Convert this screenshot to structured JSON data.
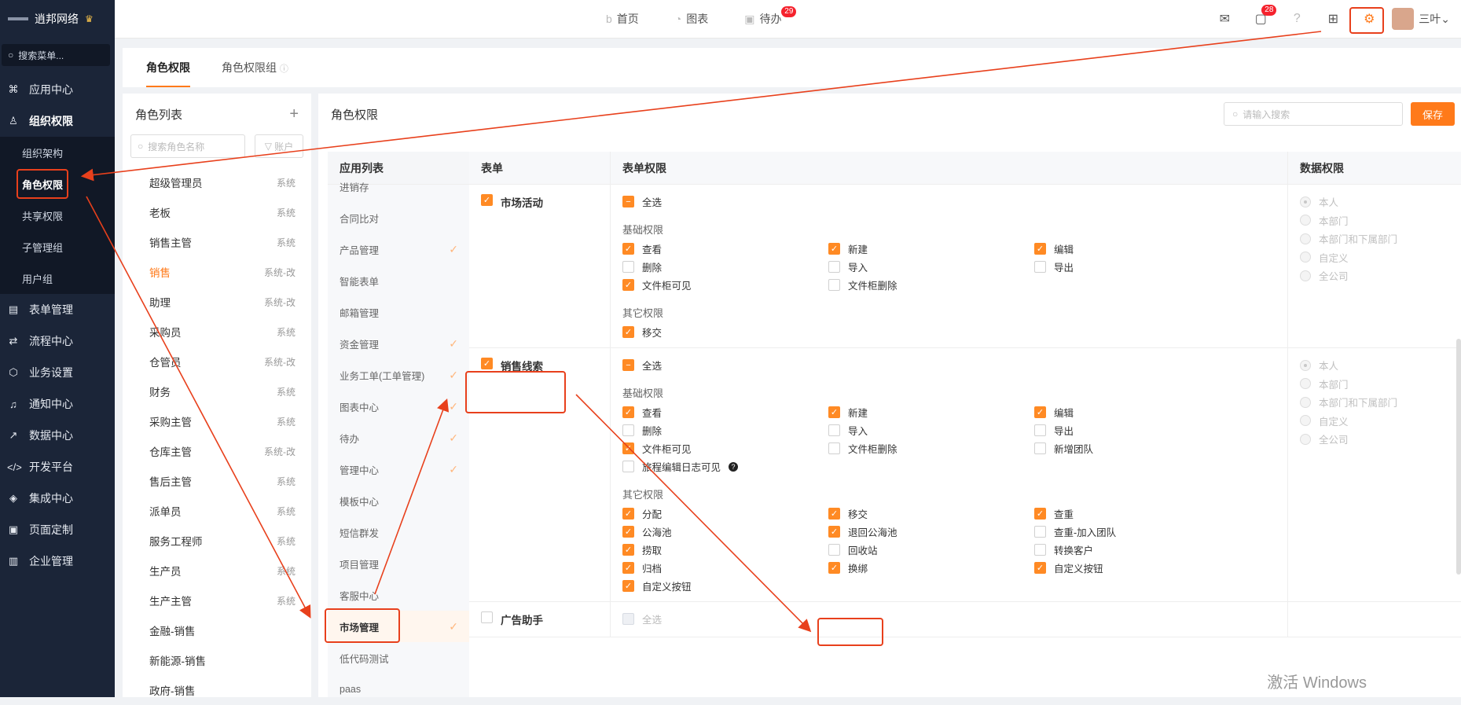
{
  "brand": {
    "name": "逍邦网络"
  },
  "sidebar": {
    "search_placeholder": "搜索菜单...",
    "items": [
      {
        "label": "应用中心",
        "icon": "grid-icon"
      },
      {
        "label": "组织权限",
        "icon": "user-icon"
      },
      {
        "label": "表单管理",
        "icon": "list-icon"
      },
      {
        "label": "流程中心",
        "icon": "flow-icon"
      },
      {
        "label": "业务设置",
        "icon": "cube-icon"
      },
      {
        "label": "通知中心",
        "icon": "bell-icon"
      },
      {
        "label": "数据中心",
        "icon": "chart-icon"
      },
      {
        "label": "开发平台",
        "icon": "code-icon"
      },
      {
        "label": "集成中心",
        "icon": "layers-icon"
      },
      {
        "label": "页面定制",
        "icon": "page-icon"
      },
      {
        "label": "企业管理",
        "icon": "building-icon"
      }
    ],
    "subitems": [
      "组织架构",
      "角色权限",
      "共享权限",
      "子管理组",
      "用户组"
    ]
  },
  "topnav": {
    "home": "首页",
    "charts": "图表",
    "todo": "待办",
    "todo_badge": "29",
    "msg_badge": "28",
    "user": "三叶"
  },
  "tabs": [
    "角色权限",
    "角色权限组"
  ],
  "role_list": {
    "title": "角色列表",
    "search_placeholder": "搜索角色名称",
    "filter": "账户",
    "roles": [
      {
        "name": "超级管理员",
        "tag": "系统"
      },
      {
        "name": "老板",
        "tag": "系统"
      },
      {
        "name": "销售主管",
        "tag": "系统"
      },
      {
        "name": "销售",
        "tag": "系统-改"
      },
      {
        "name": "助理",
        "tag": "系统-改"
      },
      {
        "name": "采购员",
        "tag": "系统"
      },
      {
        "name": "仓管员",
        "tag": "系统-改"
      },
      {
        "name": "财务",
        "tag": "系统"
      },
      {
        "name": "采购主管",
        "tag": "系统"
      },
      {
        "name": "仓库主管",
        "tag": "系统-改"
      },
      {
        "name": "售后主管",
        "tag": "系统"
      },
      {
        "name": "派单员",
        "tag": "系统"
      },
      {
        "name": "服务工程师",
        "tag": "系统"
      },
      {
        "name": "生产员",
        "tag": "系统"
      },
      {
        "name": "生产主管",
        "tag": "系统"
      },
      {
        "name": "金融-销售",
        "tag": ""
      },
      {
        "name": "新能源-销售",
        "tag": ""
      },
      {
        "name": "政府-销售",
        "tag": ""
      }
    ]
  },
  "main": {
    "title": "角色权限",
    "search_placeholder": "请输入搜索",
    "save": "保存",
    "col_app": "应用列表",
    "col_form": "表单",
    "col_perm": "表单权限",
    "col_data": "数据权限",
    "apps": [
      {
        "label": "进销存",
        "checked": false
      },
      {
        "label": "合同比对",
        "checked": false
      },
      {
        "label": "产品管理",
        "checked": true
      },
      {
        "label": "智能表单",
        "checked": false
      },
      {
        "label": "邮箱管理",
        "checked": false
      },
      {
        "label": "资金管理",
        "checked": true
      },
      {
        "label": "业务工单(工单管理)",
        "checked": true
      },
      {
        "label": "图表中心",
        "checked": true
      },
      {
        "label": "待办",
        "checked": true
      },
      {
        "label": "管理中心",
        "checked": true
      },
      {
        "label": "模板中心",
        "checked": false
      },
      {
        "label": "短信群发",
        "checked": false
      },
      {
        "label": "项目管理",
        "checked": false
      },
      {
        "label": "客服中心",
        "checked": false
      },
      {
        "label": "市场管理",
        "checked": true
      },
      {
        "label": "低代码测试",
        "checked": false
      },
      {
        "label": "paas",
        "checked": false
      }
    ],
    "select_all": "全选",
    "basic": "基础权限",
    "other": "其它权限",
    "forms": [
      {
        "name": "市场活动",
        "basic": [
          [
            "查看",
            true
          ],
          [
            "新建",
            true
          ],
          [
            "编辑",
            true
          ],
          [
            "删除",
            false
          ],
          [
            "导入",
            false
          ],
          [
            "导出",
            false
          ],
          [
            "文件柜可见",
            true
          ],
          [
            "文件柜删除",
            false
          ]
        ],
        "other": [
          [
            "移交",
            true
          ]
        ]
      },
      {
        "name": "销售线索",
        "basic": [
          [
            "查看",
            true
          ],
          [
            "新建",
            true
          ],
          [
            "编辑",
            true
          ],
          [
            "删除",
            false
          ],
          [
            "导入",
            false
          ],
          [
            "导出",
            false
          ],
          [
            "文件柜可见",
            true
          ],
          [
            "文件柜删除",
            false
          ],
          [
            "新增团队",
            false
          ],
          [
            "旅程编辑日志可见",
            false
          ]
        ],
        "other": [
          [
            "分配",
            true
          ],
          [
            "移交",
            true
          ],
          [
            "查重",
            true
          ],
          [
            "公海池",
            true
          ],
          [
            "退回公海池",
            true
          ],
          [
            "查重-加入团队",
            false
          ],
          [
            "捞取",
            true
          ],
          [
            "回收站",
            false
          ],
          [
            "转换客户",
            false
          ],
          [
            "归档",
            true
          ],
          [
            "换绑",
            true
          ],
          [
            "自定义按钮",
            true
          ],
          [
            "自定义按钮",
            true
          ]
        ]
      },
      {
        "name": "广告助手"
      }
    ],
    "data_scopes": [
      "本人",
      "本部门",
      "本部门和下属部门",
      "自定义",
      "全公司"
    ]
  },
  "watermark": "激活 Windows"
}
